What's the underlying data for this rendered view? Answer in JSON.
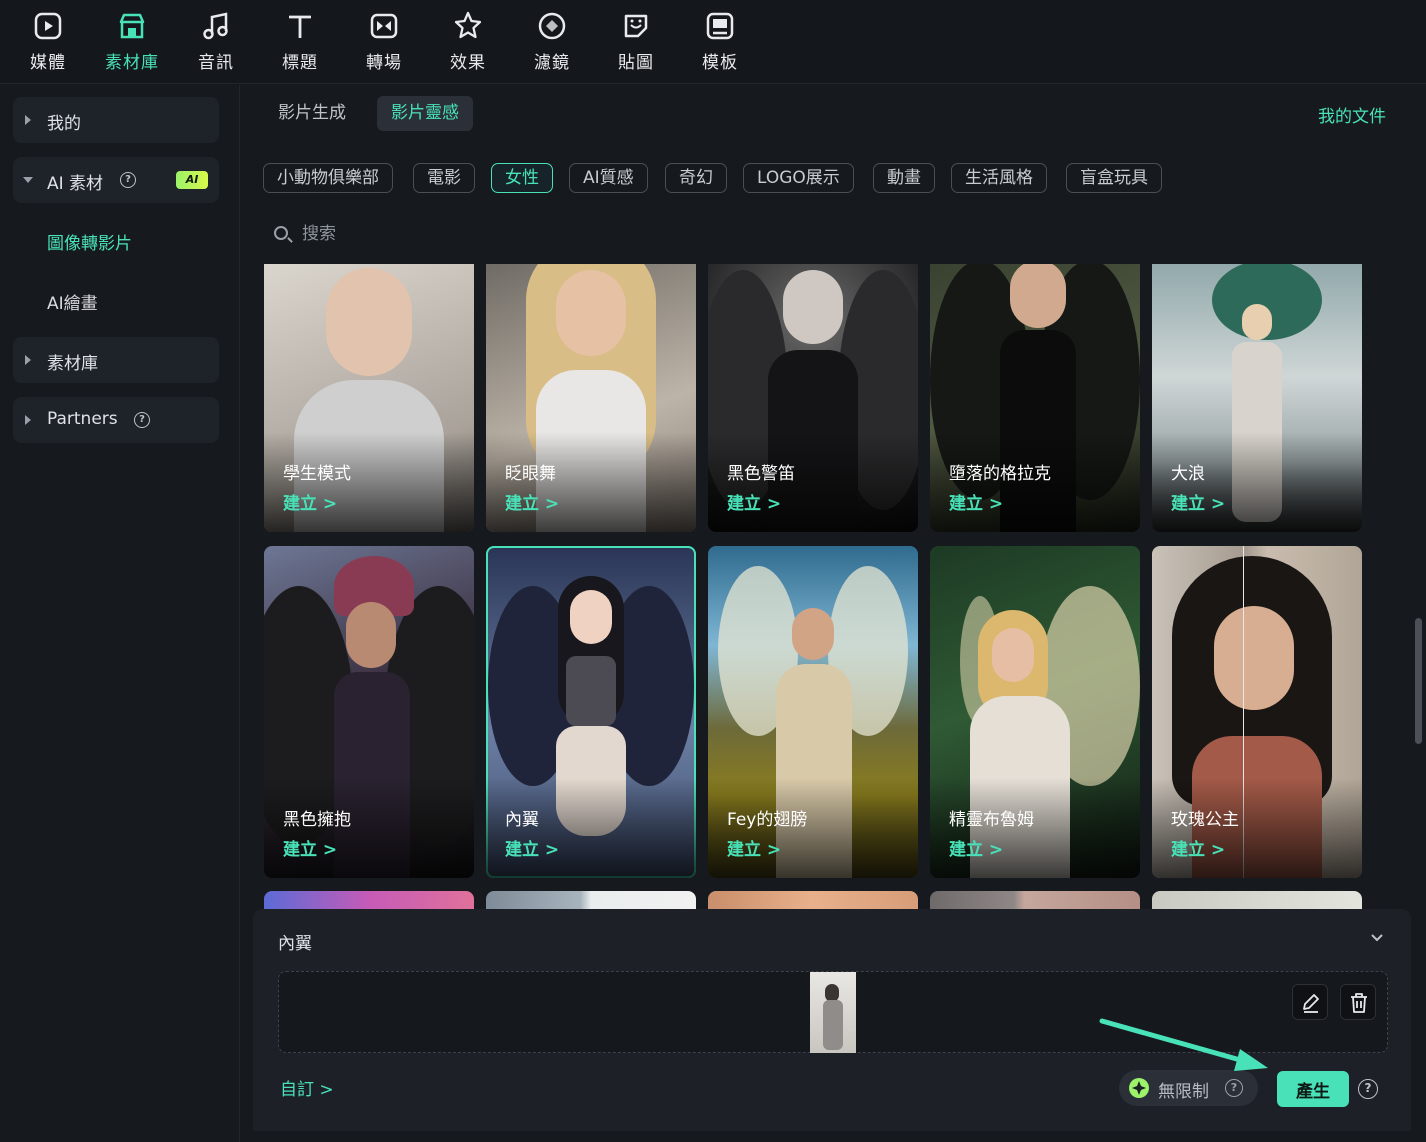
{
  "toolbar": {
    "items": [
      {
        "label": "媒體",
        "icon": "media-icon"
      },
      {
        "label": "素材庫",
        "icon": "store-icon"
      },
      {
        "label": "音訊",
        "icon": "music-note-icon"
      },
      {
        "label": "標題",
        "icon": "text-t-icon"
      },
      {
        "label": "轉場",
        "icon": "transition-icon"
      },
      {
        "label": "效果",
        "icon": "effects-star-icon"
      },
      {
        "label": "濾鏡",
        "icon": "filter-icon"
      },
      {
        "label": "貼圖",
        "icon": "sticker-icon"
      },
      {
        "label": "模板",
        "icon": "template-icon"
      }
    ],
    "active_index": 1
  },
  "sidebar": {
    "my": "我的",
    "ai_assets": "AI 素材",
    "ai_badge": "AI",
    "image_to_video": "圖像轉影片",
    "ai_painting": "AI繪畫",
    "library": "素材庫",
    "partners": "Partners",
    "help_glyph": "?"
  },
  "tabs": [
    "影片生成",
    "影片靈感"
  ],
  "active_tab": 1,
  "my_documents": "我的文件",
  "chips": [
    "小動物俱樂部",
    "電影",
    "女性",
    "AI質感",
    "奇幻",
    "LOGO展示",
    "動畫",
    "生活風格",
    "盲盒玩具"
  ],
  "active_chip": 2,
  "search": {
    "placeholder": "搜索"
  },
  "cards": [
    {
      "title": "學生模式",
      "action": "建立 >"
    },
    {
      "title": "眨眼舞",
      "action": "建立 >"
    },
    {
      "title": "黑色警笛",
      "action": "建立 >"
    },
    {
      "title": "墮落的格拉克",
      "action": "建立 >"
    },
    {
      "title": "大浪",
      "action": "建立 >"
    },
    {
      "title": "黑色擁抱",
      "action": "建立 >"
    },
    {
      "title": "內翼",
      "action": "建立 >"
    },
    {
      "title": "Fey的翅膀",
      "action": "建立 >"
    },
    {
      "title": "精靈布魯姆",
      "action": "建立 >"
    },
    {
      "title": "玫瑰公主",
      "action": "建立 >"
    }
  ],
  "selected_card": 6,
  "panel": {
    "title": "內翼",
    "custom": "自訂 >",
    "unlimited": "無限制",
    "help_glyph": "?",
    "generate": "產生"
  },
  "colors": {
    "accent": "#49e2b8",
    "background": "#16191e",
    "panel": "#1d2127"
  }
}
